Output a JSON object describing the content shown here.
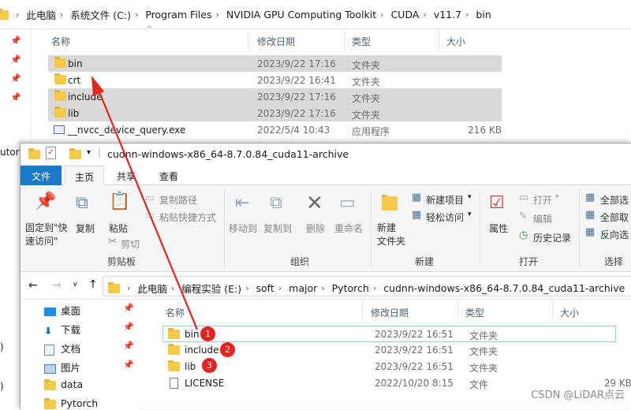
{
  "back": {
    "path": [
      "此电脑",
      "系统文件 (C:)",
      "Program Files",
      "NVIDIA GPU Computing Toolkit",
      "CUDA",
      "v11.7",
      "bin"
    ],
    "columns": {
      "name": "名称",
      "date": "修改日期",
      "type": "类型",
      "size": "大小"
    },
    "rows": [
      {
        "name": "bin",
        "date": "2023/9/22 17:16",
        "type": "文件夹",
        "size": ""
      },
      {
        "name": "crt",
        "date": "2023/9/22 16:41",
        "type": "文件夹",
        "size": ""
      },
      {
        "name": "include",
        "date": "2023/9/22 17:16",
        "type": "文件夹",
        "size": ""
      },
      {
        "name": "lib",
        "date": "2023/9/22 17:16",
        "type": "文件夹",
        "size": ""
      },
      {
        "name": "__nvcc_device_query.exe",
        "date": "2022/5/4 10:43",
        "type": "应用程序",
        "size": "216 KB"
      }
    ],
    "left_fragment": "utora"
  },
  "front": {
    "title": "cudnn-windows-x86_64-8.7.0.84_cuda11-archive",
    "tabs": [
      "文件",
      "主页",
      "共享",
      "查看"
    ],
    "ribbon": {
      "pin_quick": "固定到\"快\n速访问\"",
      "copy": "复制",
      "paste": "粘贴",
      "copy_path": "复制路径",
      "paste_shortcut": "粘贴快捷方式",
      "cut": "剪切",
      "group_clipboard": "剪贴板",
      "move_to": "移动到",
      "copy_to": "复制到",
      "delete": "删除",
      "rename": "重命名",
      "group_organize": "组织",
      "new_folder": "新建\n文件夹",
      "new_item": "新建项目",
      "easy_access": "轻松访问",
      "group_new": "新建",
      "properties": "属性",
      "open": "打开",
      "edit": "编辑",
      "history": "历史记录",
      "group_open": "打开",
      "select_all": "全部选",
      "select_none": "全部取",
      "invert": "反向选",
      "group_select": "选择"
    },
    "path": [
      "此电脑",
      "编程实验 (E:)",
      "soft",
      "major",
      "Pytorch",
      "cudnn-windows-x86_64-8.7.0.84_cuda11-archive"
    ],
    "nav": [
      "桌面",
      "下载",
      "文档",
      "图片",
      "data",
      "Pytorch"
    ],
    "columns": {
      "name": "名称",
      "date": "修改日期",
      "type": "类型",
      "size": "大小"
    },
    "rows": [
      {
        "name": "bin",
        "date": "2023/9/22 16:51",
        "type": "文件夹",
        "size": "",
        "badge": "1"
      },
      {
        "name": "include",
        "date": "2023/9/22 16:51",
        "type": "文件夹",
        "size": "",
        "badge": "2"
      },
      {
        "name": "lib",
        "date": "2023/9/22 16:51",
        "type": "文件夹",
        "size": "",
        "badge": "3"
      },
      {
        "name": "LICENSE",
        "date": "2022/10/20 8:15",
        "type": "文件",
        "size": "29 KB",
        "badge": ""
      }
    ],
    "left_fragments": [
      ")",
      ")"
    ]
  },
  "watermark": "CSDN @LiDAR点云",
  "colors": {
    "accent": "#1979ca",
    "arrow": "#e8221d",
    "folder": "#f7c948",
    "selection": "#d9d9d9"
  }
}
